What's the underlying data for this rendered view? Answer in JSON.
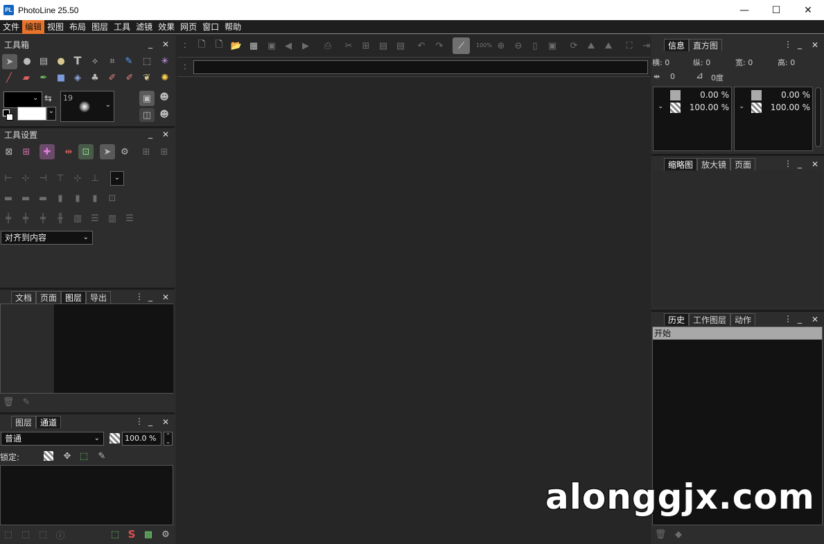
{
  "window": {
    "title": "PhotoLine 25.50",
    "logo": "PL",
    "controls": {
      "minimize": "—",
      "maximize": "☐",
      "close": "✕"
    }
  },
  "menu": [
    "文件",
    "编辑",
    "视图",
    "布局",
    "图层",
    "工具",
    "滤镜",
    "效果",
    "网页",
    "窗口",
    "帮助"
  ],
  "menu_active_index": 1,
  "accent_color": "#e8742c",
  "toolbox": {
    "title": "工具箱",
    "brush_size": "19",
    "tools_row1": [
      "arrow-icon",
      "ellipse-icon",
      "stamp-icon",
      "sphere-icon",
      "text-icon",
      "path-icon",
      "crop-icon",
      "pen-icon",
      "marquee-icon",
      "magic-wand-icon"
    ],
    "tools_row2": [
      "brush-icon",
      "eraser-icon",
      "dropper-icon",
      "gradient-icon",
      "fill-icon",
      "clone-icon",
      "smudge-icon",
      "finger-icon",
      "feather-icon",
      "light-icon"
    ]
  },
  "tool_settings": {
    "title": "工具设置",
    "align_dropdown": "对齐到内容"
  },
  "doc_panel": {
    "tabs": [
      "文档",
      "页面",
      "图层",
      "导出"
    ],
    "selected": 2
  },
  "layers_panel": {
    "tabs": [
      "图层",
      "通道"
    ],
    "selected": 1,
    "blend_mode": "普通",
    "opacity": "100.0 %",
    "lock_label": "锁定:"
  },
  "info_panel": {
    "tabs": [
      "信息",
      "直方图"
    ],
    "selected": 0,
    "x_label": "横: 0",
    "y_label": "纵: 0",
    "w_label": "宽: 0",
    "h_label": "高: 0",
    "distance": "0",
    "angle": "0度",
    "color_a_top": "0.00 %",
    "color_a_bottom": "100.00 %",
    "color_b_top": "0.00 %",
    "color_b_bottom": "100.00 %"
  },
  "navigator_panel": {
    "tabs": [
      "缩略图",
      "放大镜",
      "页面"
    ],
    "selected": 0
  },
  "history_panel": {
    "tabs": [
      "历史",
      "工作图层",
      "动作"
    ],
    "selected": 0,
    "items": [
      "开始"
    ]
  },
  "zoom_label": "100%",
  "watermark": "alonggjx.com",
  "panel_controls": {
    "menu": "⋮",
    "minimize": "_",
    "close": "✕"
  }
}
